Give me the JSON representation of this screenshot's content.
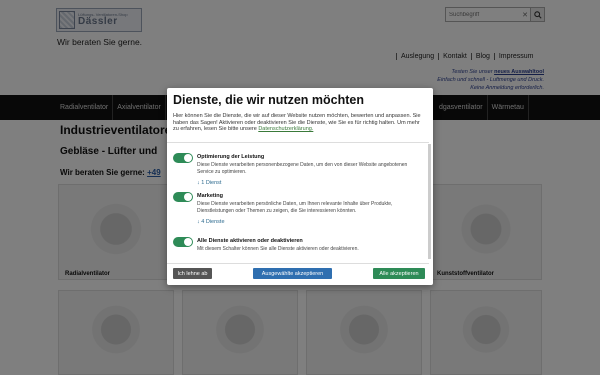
{
  "logo": {
    "small": "Lüftungs- Ventilatoren-Shop",
    "big": "Dässler"
  },
  "tagline": "Wir beraten Sie gerne.",
  "search": {
    "placeholder": "Suchbegriff",
    "clear": "✕"
  },
  "topnav": [
    "Auslegung",
    "Kontakt",
    "Blog",
    "Impressum"
  ],
  "promo": {
    "line1_pre": "Testen Sie unser ",
    "line1_link": "neues Auswahltool",
    "line2": "Einfach und schnell - Luftmenge und Druck.",
    "line3": "Keine Anmeldung erforderlich."
  },
  "mainnav": {
    "items": [
      "Radialventilator",
      "Axialventilator"
    ],
    "right": [
      "dgasventilator",
      "Wärmetau"
    ]
  },
  "page": {
    "title": "Industrieventilatoren",
    "subtitle": "Gebläse - Lüfter und",
    "advise": "Wir beraten Sie gerne:",
    "advise_link": "+49"
  },
  "tiles": [
    {
      "caption": "Radialventilator"
    },
    {
      "caption": ""
    },
    {
      "caption": ""
    },
    {
      "caption": "Kunststoffventilator"
    },
    {
      "caption": ""
    },
    {
      "caption": ""
    },
    {
      "caption": ""
    },
    {
      "caption": ""
    }
  ],
  "consent": {
    "title": "Dienste, die wir nutzen möchten",
    "intro": "Hier können Sie die Dienste, die wir auf dieser Website nutzen möchten, bewerten und anpassen. Sie haben das Sagen! Aktivieren oder deaktivieren Sie die Dienste, wie Sie es für richtig halten. Um mehr zu erfahren, lesen Sie bitte unsere",
    "intro_link": "Datenschutzerklärung.",
    "services": [
      {
        "title": "Optimierung der Leistung",
        "desc": "Diese Dienste verarbeiten personenbezogene Daten, um den von dieser Website angebotenen Service zu optimieren.",
        "count": "↓ 1 Dienst",
        "enabled": true
      },
      {
        "title": "Marketing",
        "desc": "Diese Dienste verarbeiten persönliche Daten, um Ihnen relevante Inhalte über Produkte, Dienstleistungen oder Themen zu zeigen, die Sie interessieren könnten.",
        "count": "↓ 4 Dienste",
        "enabled": true
      },
      {
        "title": "Alle Dienste aktivieren oder deaktivieren",
        "desc": "Mit diesem Schalter können Sie alle Dienste aktivieren oder deaktivieren.",
        "count": "",
        "enabled": true
      }
    ],
    "buttons": {
      "decline": "Ich lehne ab",
      "selected": "Ausgewählte akzeptieren",
      "all": "Alle akzeptieren"
    }
  },
  "colors": {
    "accept_all": "#2e8b57",
    "accept_selected": "#2f6fb0",
    "decline": "#555555",
    "nav": "#111111"
  }
}
